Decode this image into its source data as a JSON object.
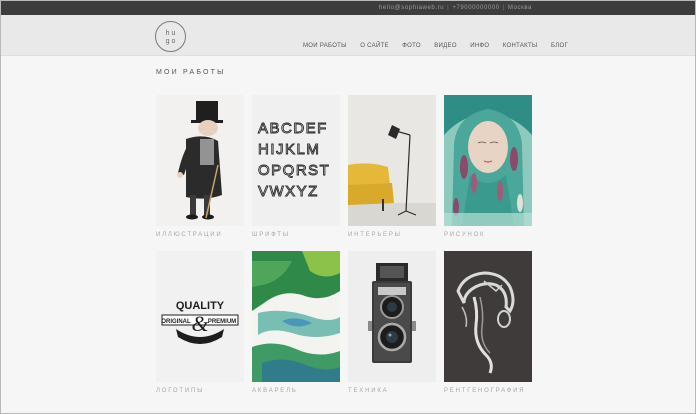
{
  "topbar": {
    "email": "hello@sophiaweb.ru",
    "phone": "+79000000000",
    "city": "Москва",
    "separator": "|"
  },
  "logo": {
    "line1": "hu",
    "line2": "go"
  },
  "nav": {
    "items": [
      {
        "label": "МОИ РАБОТЫ"
      },
      {
        "label": "О САЙТЕ"
      },
      {
        "label": "ФОТО"
      },
      {
        "label": "ВИДЕО"
      },
      {
        "label": "ИНФО"
      },
      {
        "label": "КОНТАКТЫ"
      },
      {
        "label": "БЛОГ"
      }
    ]
  },
  "main": {
    "title": "МОИ РАБОТЫ",
    "works": [
      {
        "caption": "ИЛЛЮСТРАЦИИ",
        "icon": "illustration-image"
      },
      {
        "caption": "ШРИФТЫ",
        "icon": "fonts-image",
        "letters": [
          "ABCDEF",
          "HIJKLM",
          "OPQRST",
          "VWXYZ"
        ]
      },
      {
        "caption": "ИНТЕРЬЕРЫ",
        "icon": "interior-image"
      },
      {
        "caption": "РИСУНОК",
        "icon": "drawing-image"
      },
      {
        "caption": "ЛОГОТИПЫ",
        "icon": "logo-image",
        "badge_top": "QUALITY",
        "badge_left": "ORIGINAL",
        "badge_right": "PREMIUM",
        "badge_amp": "&"
      },
      {
        "caption": "АКВАРЕЛЬ",
        "icon": "watercolor-image"
      },
      {
        "caption": "ТЕХНИКА",
        "icon": "camera-image"
      },
      {
        "caption": "РЕНТГЕНОГРАФИЯ",
        "icon": "xray-image"
      }
    ]
  },
  "colors": {
    "topbar": "#3d3d3d",
    "header": "#e9e9e9",
    "page": "#f6f6f6",
    "caption": "#a7a7a7"
  }
}
